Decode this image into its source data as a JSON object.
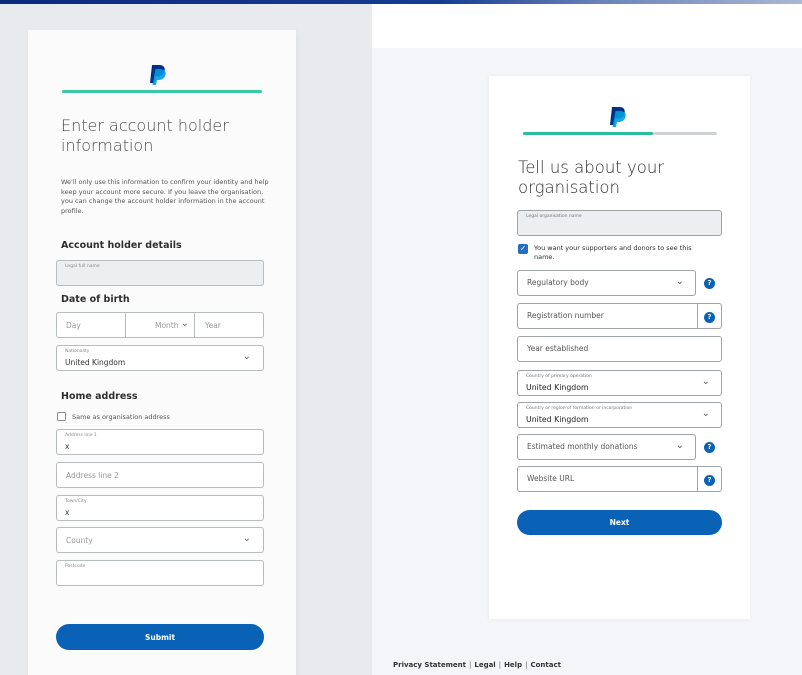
{
  "left": {
    "title": "Enter account holder information",
    "description": "We'll only use this information to confirm your identity and help keep your account more secure. If you leave the organisation, you can change the account holder information in the account profile.",
    "account_heading": "Account holder details",
    "legal_name_label": "Legal full name",
    "dob_heading": "Date of birth",
    "dob_day": "Day",
    "dob_month": "Month",
    "dob_year": "Year",
    "nationality_label": "Nationality",
    "nationality_value": "United Kingdom",
    "home_heading": "Home address",
    "same_as_label": "Same as organisation address",
    "address1_label": "Address line 1",
    "address1_value": "x",
    "address2_placeholder": "Address line 2",
    "town_label": "Town/City",
    "town_value": "x",
    "county_placeholder": "County",
    "postcode_label": "Postcode",
    "submit_label": "Submit"
  },
  "right": {
    "progress_fraction": 0.67,
    "title": "Tell us about your organisation",
    "legal_org_label": "Legal organisation name",
    "supporters_checkbox_label": "You want your supporters and donors to see this name.",
    "regulatory_placeholder": "Regulatory body",
    "registration_placeholder": "Registration number",
    "year_placeholder": "Year established",
    "country_label": "Country of primary operation",
    "country_value": "United Kingdom",
    "formation_label": "Country or region of formation or incorporation",
    "formation_value": "United Kingdom",
    "donations_placeholder": "Estimated monthly donations",
    "website_placeholder": "Website URL",
    "next_label": "Next",
    "help_glyph": "?"
  },
  "footer": {
    "privacy": "Privacy Statement",
    "legal": "Legal",
    "help": "Help",
    "contact": "Contact",
    "separator": "|"
  },
  "icons": {
    "logo": "paypal-logo",
    "chevron": "chevron-down-icon",
    "help": "question-icon",
    "check": "checkmark-icon"
  },
  "colors": {
    "primary_button": "#0a62b6",
    "progress": "#2bbd9b",
    "help_icon": "#0a62b6",
    "logo_dark": "#003087",
    "logo_light": "#009cde"
  }
}
